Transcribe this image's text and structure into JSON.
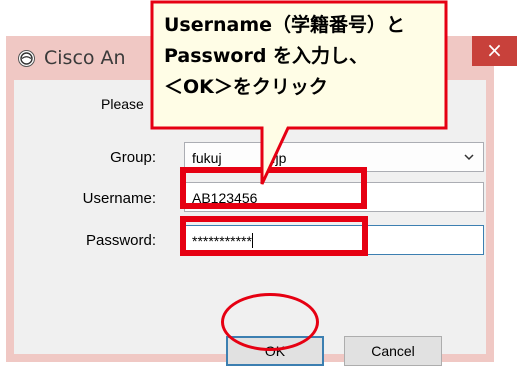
{
  "dialog": {
    "title": "Cisco An",
    "close_label": "×",
    "prompt": "Please",
    "group_label": "Group:",
    "group_value": "fukuj",
    "group_value_suffix": ".jp",
    "username_label": "Username:",
    "username_value": "AB123456",
    "password_label": "Password:",
    "password_value": "***********",
    "ok_label": "OK",
    "cancel_label": "Cancel"
  },
  "callout": {
    "line1": "Username（学籍番号）と",
    "line2": "Password を入力し、",
    "line3": "＜OK＞をクリック"
  },
  "colors": {
    "annotation_red": "#e60012",
    "callout_fill": "#fffde6",
    "titlebar": "#f0c8c4",
    "close_button": "#c8413b"
  }
}
